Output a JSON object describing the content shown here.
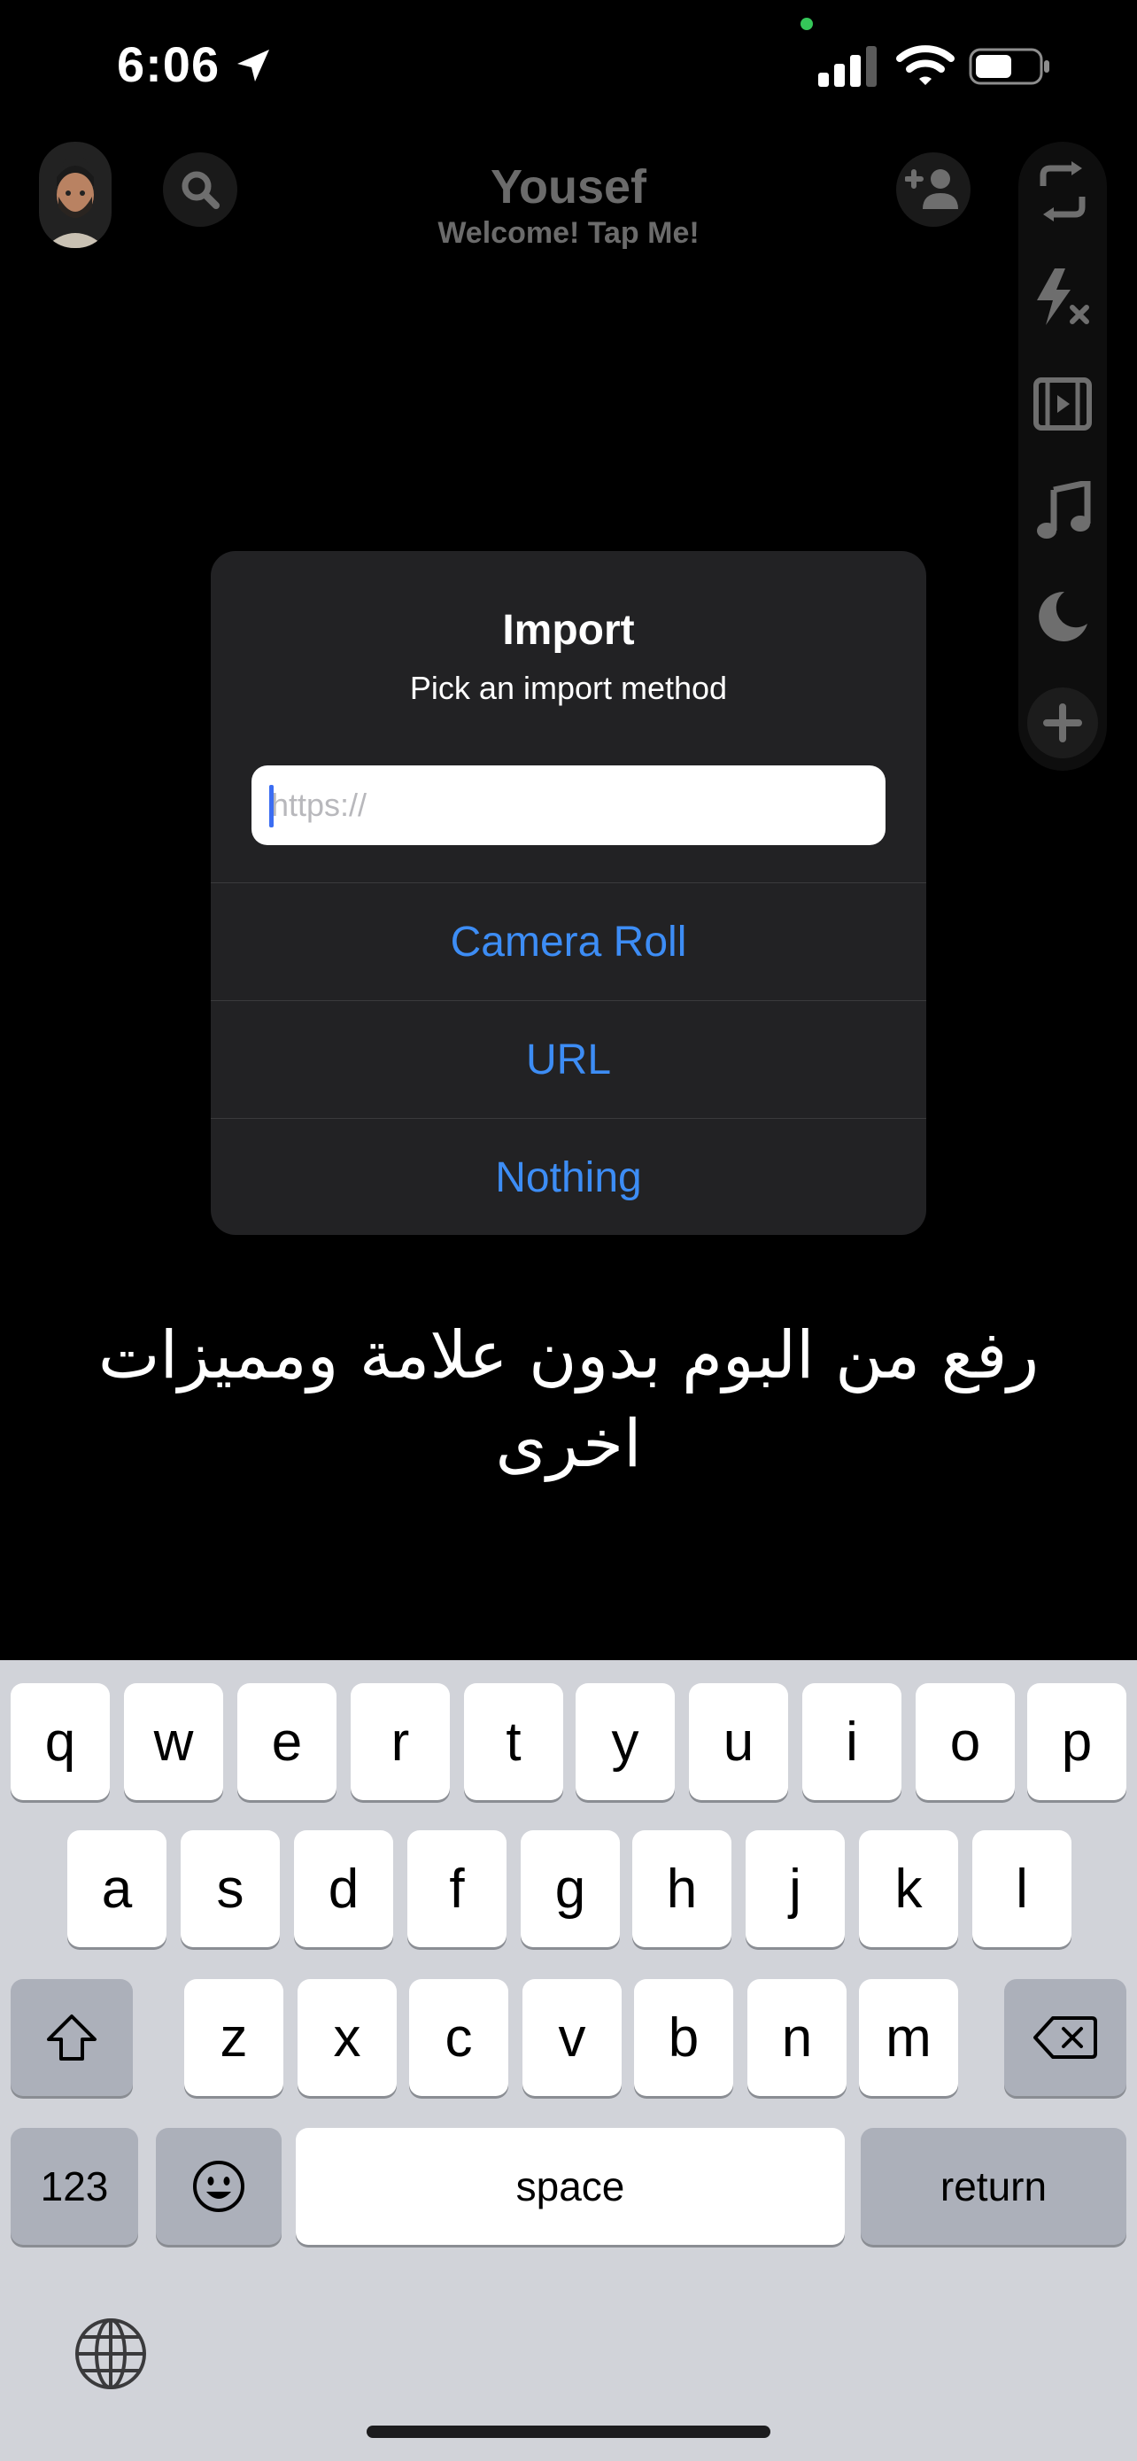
{
  "status_bar": {
    "time": "6:06"
  },
  "header": {
    "title": "Yousef",
    "subtitle": "Welcome! Tap Me!"
  },
  "dialog": {
    "title": "Import",
    "message": "Pick an import method",
    "input_placeholder": "https://",
    "buttons": [
      "Camera Roll",
      "URL",
      "Nothing"
    ]
  },
  "caption": "رفع من البوم بدون علامة ومميزات اخرى",
  "keyboard": {
    "row1": [
      "q",
      "w",
      "e",
      "r",
      "t",
      "y",
      "u",
      "i",
      "o",
      "p"
    ],
    "row2": [
      "a",
      "s",
      "d",
      "f",
      "g",
      "h",
      "j",
      "k",
      "l"
    ],
    "row3": [
      "z",
      "x",
      "c",
      "v",
      "b",
      "n",
      "m"
    ],
    "numbers_label": "123",
    "space_label": "space",
    "return_label": "return"
  },
  "colors": {
    "accent": "#3d8df5",
    "dialog_bg": "#222224",
    "keyboard_bg": "#d1d3d9"
  },
  "icons": [
    "location-arrow-icon",
    "signal-icon",
    "wifi-icon",
    "battery-icon",
    "search-icon",
    "add-friend-icon",
    "flip-camera-icon",
    "flash-off-icon",
    "video-icon",
    "music-icon",
    "night-mode-icon",
    "plus-icon",
    "shift-icon",
    "delete-icon",
    "emoji-icon",
    "globe-icon"
  ]
}
